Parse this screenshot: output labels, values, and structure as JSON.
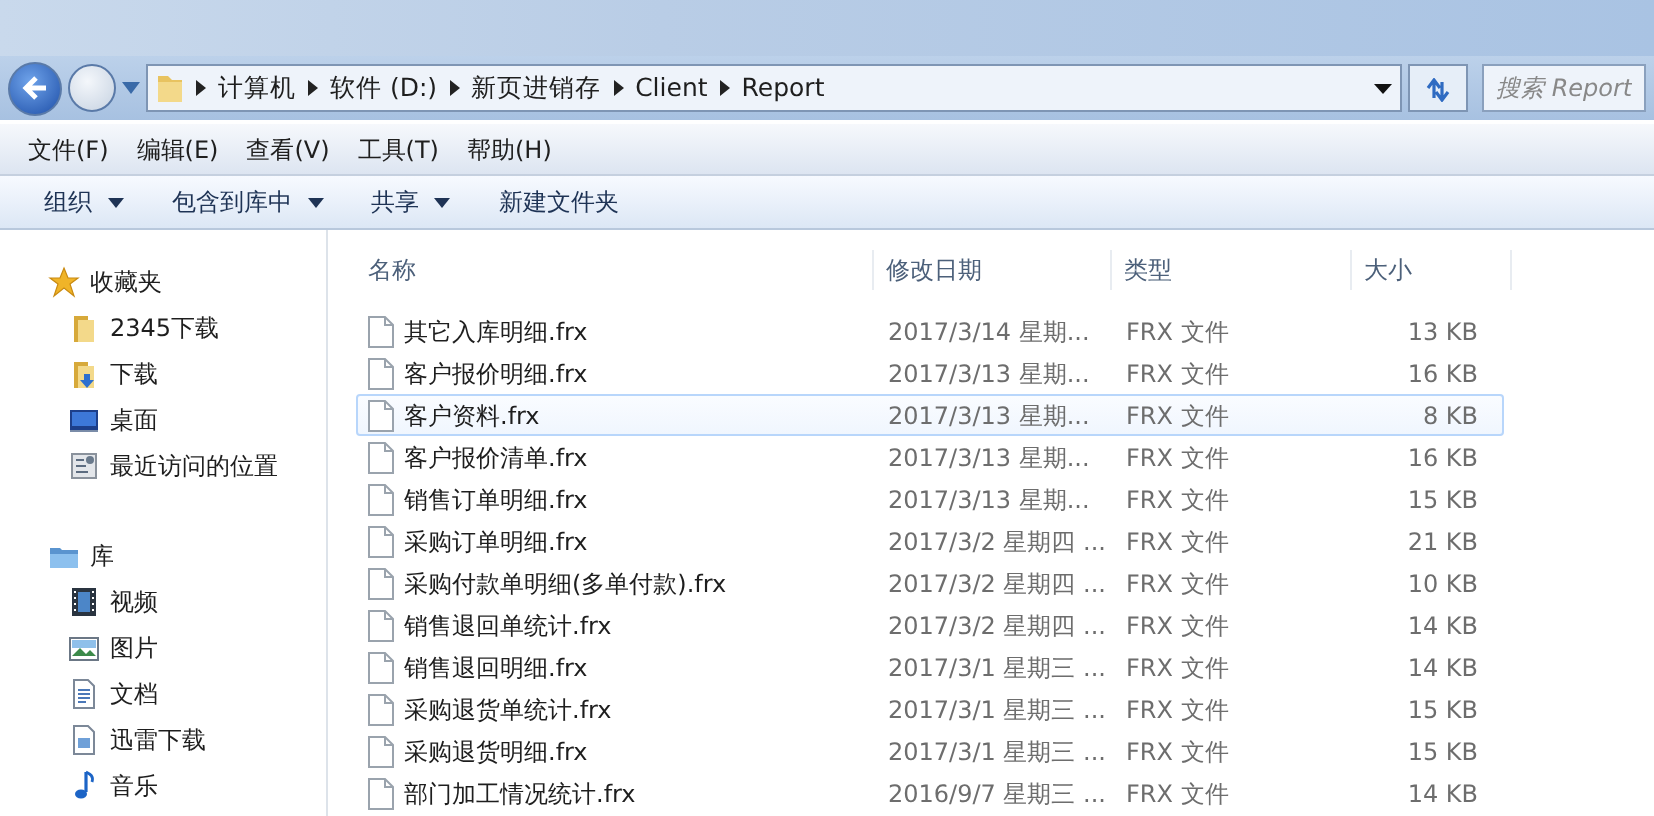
{
  "breadcrumb": [
    "计算机",
    "软件 (D:)",
    "新页进销存",
    "Client",
    "Report"
  ],
  "search": {
    "placeholder": "搜索 Report"
  },
  "menu": [
    "文件(F)",
    "编辑(E)",
    "查看(V)",
    "工具(T)",
    "帮助(H)"
  ],
  "commands": [
    {
      "label": "组织",
      "dropdown": true
    },
    {
      "label": "包含到库中",
      "dropdown": true
    },
    {
      "label": "共享",
      "dropdown": true
    },
    {
      "label": "新建文件夹",
      "dropdown": false
    }
  ],
  "sidebar": [
    {
      "label": "收藏夹",
      "kind": "star",
      "children": [
        {
          "label": "2345下载",
          "kind": "folder"
        },
        {
          "label": "下载",
          "kind": "download"
        },
        {
          "label": "桌面",
          "kind": "desktop"
        },
        {
          "label": "最近访问的位置",
          "kind": "recent"
        }
      ]
    },
    {
      "label": "库",
      "kind": "library",
      "children": [
        {
          "label": "视频",
          "kind": "video"
        },
        {
          "label": "图片",
          "kind": "image"
        },
        {
          "label": "文档",
          "kind": "doc"
        },
        {
          "label": "迅雷下载",
          "kind": "doc2"
        },
        {
          "label": "音乐",
          "kind": "music"
        }
      ]
    }
  ],
  "columns": [
    "名称",
    "修改日期",
    "类型",
    "大小"
  ],
  "files": [
    {
      "name": "其它入库明细.frx",
      "date": "2017/3/14 星期...",
      "type": "FRX 文件",
      "size": "13 KB",
      "selected": false
    },
    {
      "name": "客户报价明细.frx",
      "date": "2017/3/13 星期...",
      "type": "FRX 文件",
      "size": "16 KB",
      "selected": false
    },
    {
      "name": "客户资料.frx",
      "date": "2017/3/13 星期...",
      "type": "FRX 文件",
      "size": "8 KB",
      "selected": true
    },
    {
      "name": "客户报价清单.frx",
      "date": "2017/3/13 星期...",
      "type": "FRX 文件",
      "size": "16 KB",
      "selected": false
    },
    {
      "name": "销售订单明细.frx",
      "date": "2017/3/13 星期...",
      "type": "FRX 文件",
      "size": "15 KB",
      "selected": false
    },
    {
      "name": "采购订单明细.frx",
      "date": "2017/3/2 星期四 ...",
      "type": "FRX 文件",
      "size": "21 KB",
      "selected": false
    },
    {
      "name": "采购付款单明细(多单付款).frx",
      "date": "2017/3/2 星期四 ...",
      "type": "FRX 文件",
      "size": "10 KB",
      "selected": false
    },
    {
      "name": "销售退回单统计.frx",
      "date": "2017/3/2 星期四 ...",
      "type": "FRX 文件",
      "size": "14 KB",
      "selected": false
    },
    {
      "name": "销售退回明细.frx",
      "date": "2017/3/1 星期三 ...",
      "type": "FRX 文件",
      "size": "14 KB",
      "selected": false
    },
    {
      "name": "采购退货单统计.frx",
      "date": "2017/3/1 星期三 ...",
      "type": "FRX 文件",
      "size": "15 KB",
      "selected": false
    },
    {
      "name": "采购退货明细.frx",
      "date": "2017/3/1 星期三 ...",
      "type": "FRX 文件",
      "size": "15 KB",
      "selected": false
    },
    {
      "name": "部门加工情况统计.frx",
      "date": "2016/9/7 星期三 ...",
      "type": "FRX 文件",
      "size": "14 KB",
      "selected": false
    }
  ]
}
